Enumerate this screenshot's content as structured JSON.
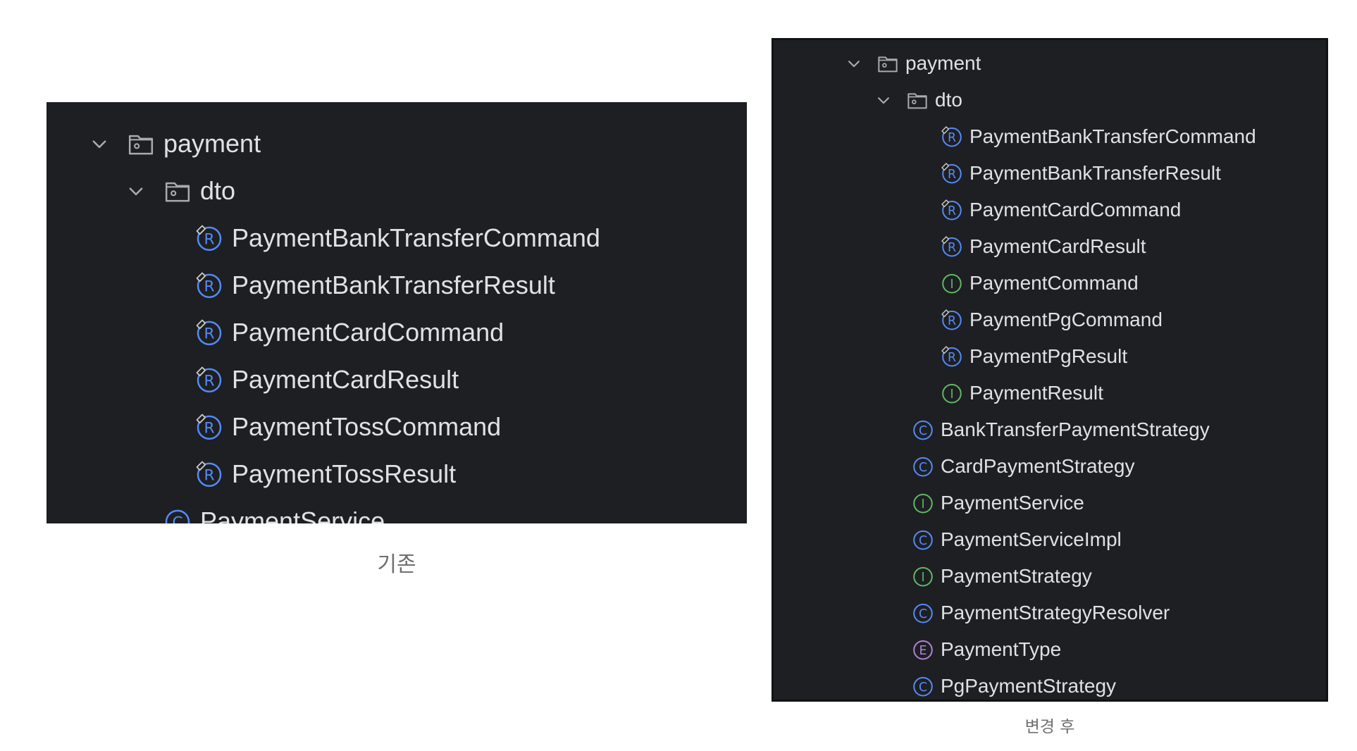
{
  "colors": {
    "panel_bg": "#1e1f22",
    "text": "#dfe1e5",
    "folder_icon": "#a9abaf",
    "record_icon": "#548af7",
    "class_icon": "#548af7",
    "interface_icon": "#5fb865",
    "enum_icon": "#b180d7",
    "caption": "#6f6f6f"
  },
  "before": {
    "caption": "기존",
    "items": [
      {
        "label": "payment",
        "icon": "folder-icon",
        "expanded": true
      },
      {
        "label": "dto",
        "icon": "folder-icon",
        "expanded": true
      },
      {
        "label": "PaymentBankTransferCommand",
        "icon": "record-icon"
      },
      {
        "label": "PaymentBankTransferResult",
        "icon": "record-icon"
      },
      {
        "label": "PaymentCardCommand",
        "icon": "record-icon"
      },
      {
        "label": "PaymentCardResult",
        "icon": "record-icon"
      },
      {
        "label": "PaymentTossCommand",
        "icon": "record-icon"
      },
      {
        "label": "PaymentTossResult",
        "icon": "record-icon"
      },
      {
        "label": "PaymentService",
        "icon": "class-icon"
      }
    ]
  },
  "after": {
    "caption": "변경 후",
    "items": [
      {
        "label": "payment",
        "icon": "folder-icon",
        "expanded": true
      },
      {
        "label": "dto",
        "icon": "folder-icon",
        "expanded": true
      },
      {
        "label": "PaymentBankTransferCommand",
        "icon": "record-icon"
      },
      {
        "label": "PaymentBankTransferResult",
        "icon": "record-icon"
      },
      {
        "label": "PaymentCardCommand",
        "icon": "record-icon"
      },
      {
        "label": "PaymentCardResult",
        "icon": "record-icon"
      },
      {
        "label": "PaymentCommand",
        "icon": "interface-icon"
      },
      {
        "label": "PaymentPgCommand",
        "icon": "record-icon"
      },
      {
        "label": "PaymentPgResult",
        "icon": "record-icon"
      },
      {
        "label": "PaymentResult",
        "icon": "interface-icon"
      },
      {
        "label": "BankTransferPaymentStrategy",
        "icon": "class-icon"
      },
      {
        "label": "CardPaymentStrategy",
        "icon": "class-icon"
      },
      {
        "label": "PaymentService",
        "icon": "interface-icon"
      },
      {
        "label": "PaymentServiceImpl",
        "icon": "class-icon"
      },
      {
        "label": "PaymentStrategy",
        "icon": "interface-icon"
      },
      {
        "label": "PaymentStrategyResolver",
        "icon": "class-icon"
      },
      {
        "label": "PaymentType",
        "icon": "enum-icon"
      },
      {
        "label": "PgPaymentStrategy",
        "icon": "class-icon"
      }
    ]
  }
}
